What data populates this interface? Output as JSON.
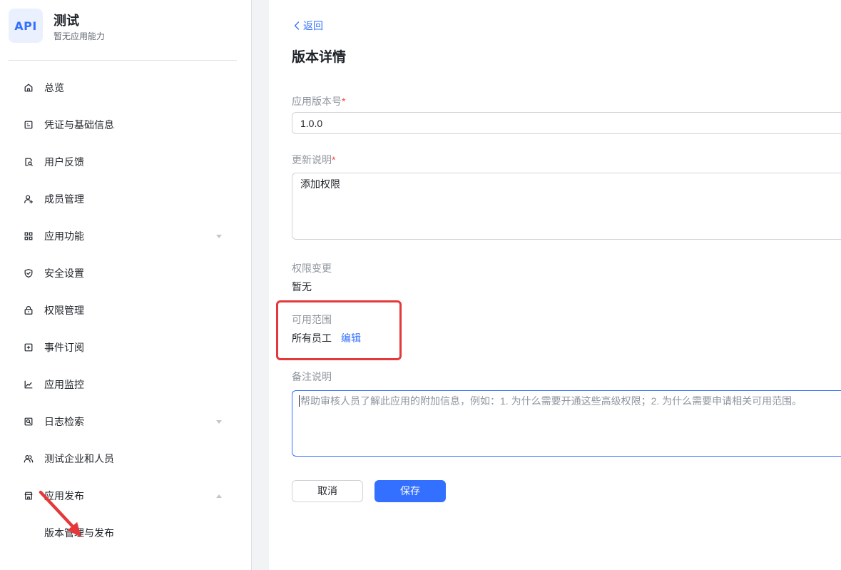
{
  "app": {
    "icon_text": "API",
    "name": "测试",
    "subtitle": "暂无应用能力"
  },
  "sidebar": {
    "items": [
      {
        "label": "总览",
        "icon": "home-icon"
      },
      {
        "label": "凭证与基础信息",
        "icon": "credential-icon"
      },
      {
        "label": "用户反馈",
        "icon": "feedback-icon"
      },
      {
        "label": "成员管理",
        "icon": "user-add-icon"
      },
      {
        "label": "应用功能",
        "icon": "grid-icon",
        "expanded": false
      },
      {
        "label": "安全设置",
        "icon": "shield-icon"
      },
      {
        "label": "权限管理",
        "icon": "lock-icon"
      },
      {
        "label": "事件订阅",
        "icon": "subscribe-icon"
      },
      {
        "label": "应用监控",
        "icon": "chart-icon"
      },
      {
        "label": "日志检索",
        "icon": "log-search-icon",
        "expanded": false
      },
      {
        "label": "测试企业和人员",
        "icon": "users-icon"
      },
      {
        "label": "应用发布",
        "icon": "store-icon",
        "expanded": true,
        "children": [
          {
            "label": "版本管理与发布"
          }
        ]
      }
    ]
  },
  "main": {
    "back_label": "返回",
    "title": "版本详情",
    "version": {
      "label": "应用版本号",
      "required_mark": "*",
      "value": "1.0.0"
    },
    "update_notes": {
      "label": "更新说明",
      "required_mark": "*",
      "value": "添加权限"
    },
    "permission_changes": {
      "label": "权限变更",
      "value": "暂无"
    },
    "scope": {
      "label": "可用范围",
      "value": "所有员工",
      "edit_label": "编辑"
    },
    "remarks": {
      "label": "备注说明",
      "value": "",
      "placeholder": "帮助审核人员了解此应用的附加信息，例如：1. 为什么需要开通这些高级权限；2. 为什么需要申请相关可用范围。",
      "focused": true
    },
    "buttons": {
      "cancel": "取消",
      "save": "保存"
    }
  },
  "colors": {
    "accent": "#3370ff",
    "text": "#1f2329",
    "label": "#8f959e",
    "required": "#f54a45",
    "annotation": "#e5383b"
  }
}
